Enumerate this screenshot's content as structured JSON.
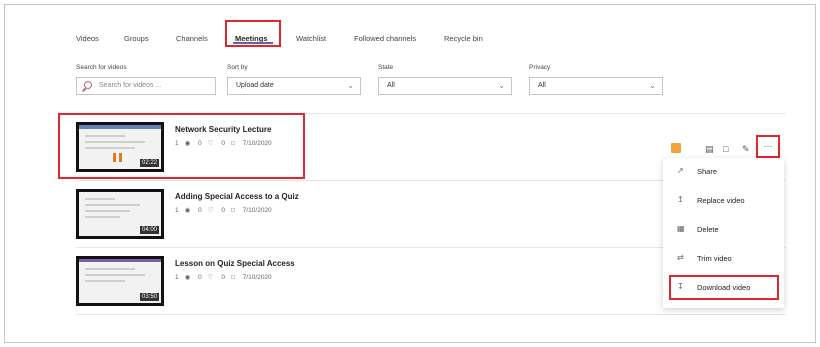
{
  "tabs": [
    "Videos",
    "Groups",
    "Channels",
    "Meetings",
    "Watchlist",
    "Followed channels",
    "Recycle bin"
  ],
  "active_tab": "Meetings",
  "filters": {
    "search_label": "Search for videos",
    "search_placeholder": "Search for videos ...",
    "sort_label": "Sort by",
    "sort_value": "Upload date",
    "state_label": "State",
    "state_value": "All",
    "privacy_label": "Privacy",
    "privacy_value": "All"
  },
  "videos": [
    {
      "title": "Network Security Lecture",
      "views": "1",
      "likes": "0",
      "comments": "0",
      "date": "7/10/2020",
      "duration": "02:22"
    },
    {
      "title": "Adding Special Access to a Quiz",
      "views": "1",
      "likes": "0",
      "comments": "0",
      "date": "7/10/2020",
      "duration": "04:00"
    },
    {
      "title": "Lesson on Quiz Special Access",
      "views": "1",
      "likes": "0",
      "comments": "0",
      "date": "7/10/2020",
      "duration": "03:50"
    }
  ],
  "row_actions": {
    "more_label": "···"
  },
  "menu": [
    {
      "label": "Share",
      "icon": "share-icon"
    },
    {
      "label": "Replace video",
      "icon": "upload-icon"
    },
    {
      "label": "Delete",
      "icon": "trash-icon"
    },
    {
      "label": "Trim video",
      "icon": "trim-icon"
    },
    {
      "label": "Download video",
      "icon": "download-icon"
    }
  ],
  "colors": {
    "highlight": "#e2262b",
    "accent": "#6264a7",
    "flag": "#f4a23a"
  }
}
